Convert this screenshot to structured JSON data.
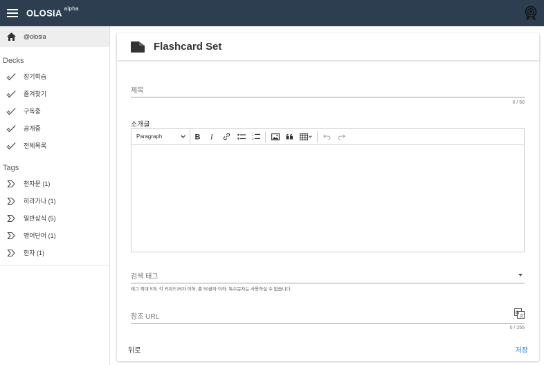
{
  "app": {
    "brand": "OLOSIA",
    "brand_sup": "alpha"
  },
  "sidebar": {
    "user": "@olosia",
    "decks_title": "Decks",
    "decks": [
      {
        "label": "장기학습",
        "icon": "check-icon"
      },
      {
        "label": "즐겨찾기",
        "icon": "check-icon"
      },
      {
        "label": "구독중",
        "icon": "check-icon"
      },
      {
        "label": "공개중",
        "icon": "check-icon"
      },
      {
        "label": "전체목록",
        "icon": "check-icon"
      }
    ],
    "tags_title": "Tags",
    "tags": [
      {
        "label": "천자문 (1)",
        "icon": "label-icon"
      },
      {
        "label": "히라가나 (1)",
        "icon": "label-icon"
      },
      {
        "label": "일반상식 (5)",
        "icon": "label-icon"
      },
      {
        "label": "영어단어 (1)",
        "icon": "label-icon"
      },
      {
        "label": "한자 (1)",
        "icon": "label-icon"
      }
    ]
  },
  "card": {
    "title": "Flashcard Set",
    "title_field": {
      "placeholder": "제목",
      "value": "",
      "counter": "0 / 50"
    },
    "description": {
      "label": "소개글",
      "format_select": "Paragraph",
      "toolbar_icons": [
        "bold-icon",
        "italic-icon",
        "link-icon",
        "bulleted-list-icon",
        "numbered-list-icon",
        "image-icon",
        "quote-icon",
        "table-icon",
        "undo-icon",
        "redo-icon"
      ]
    },
    "tags_field": {
      "placeholder": "검색 태그",
      "hint": "태그 최대 5개. 각 키워드35자 이하, 총 50글자 이하. 특수문자는 사용하실 수 없습니다."
    },
    "url_field": {
      "placeholder": "참조 URL",
      "counter": "0 / 255"
    },
    "back_label": "뒤로",
    "save_label": "저장"
  },
  "colors": {
    "appbar": "#2c3e50",
    "accent": "#1e88e5"
  }
}
